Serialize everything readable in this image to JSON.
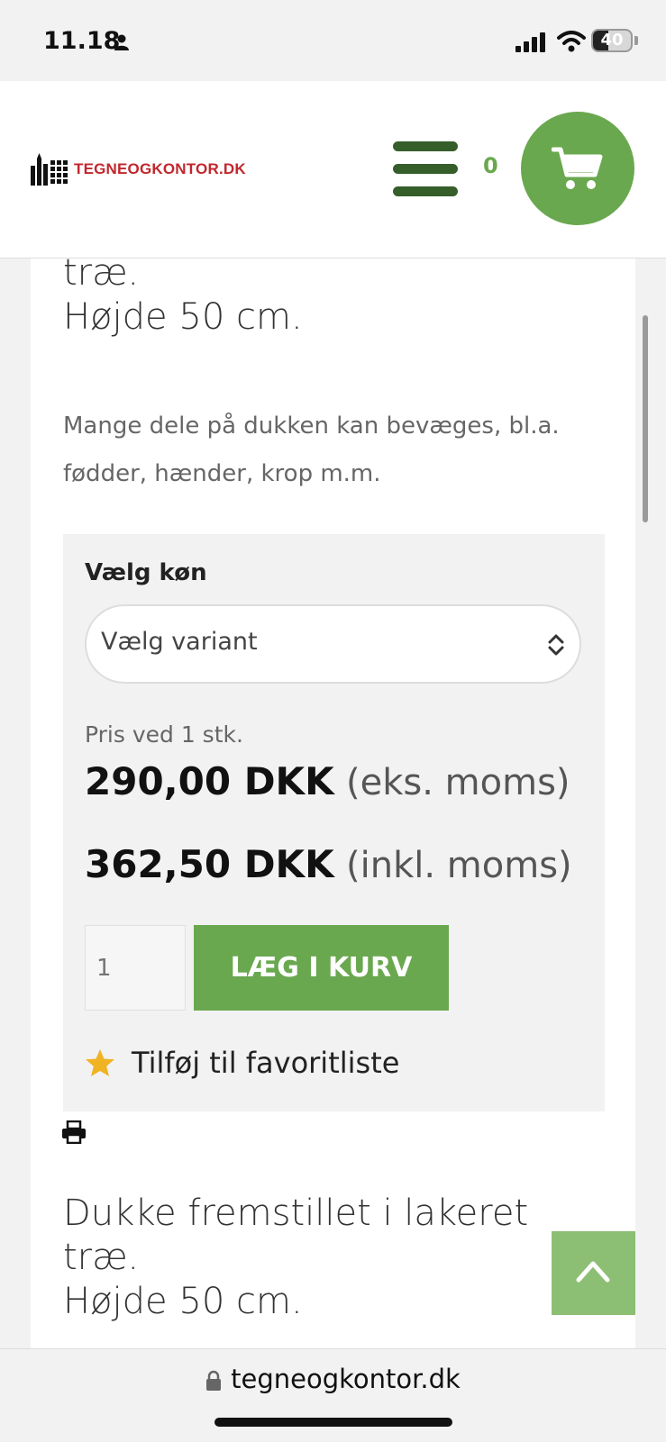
{
  "status": {
    "time": "11.18",
    "battery": "40",
    "battery_fraction": 0.4
  },
  "header": {
    "logo_text": "TEGNEOGKONTOR.DK",
    "cart_count": "0",
    "brand_color": "#c1272d",
    "accent_color": "#6aa84f",
    "menu_color": "#355e2a"
  },
  "product": {
    "heading_top_lines": [
      "træ.",
      "Højde 50 cm."
    ],
    "description": "Mange dele på dukken kan bevæges, bl.a. fødder, hænder, krop m.m.",
    "variant_label": "Vælg køn",
    "variant_value": "Vælg variant",
    "price_note": "Pris ved 1 stk.",
    "price_ex": "290,00 DKK",
    "price_ex_suffix": "(eks. moms)",
    "price_inc": "362,50 DKK",
    "price_inc_suffix": "(inkl. moms)",
    "quantity_placeholder": "1",
    "add_to_cart": "LÆG I KURV",
    "favorite": "Tilføj til favoritliste",
    "heading_bottom_lines": [
      "Dukke fremstillet i lakeret",
      "træ.",
      "Højde 50 cm."
    ]
  },
  "browser": {
    "url": "tegneogkontor.dk"
  }
}
